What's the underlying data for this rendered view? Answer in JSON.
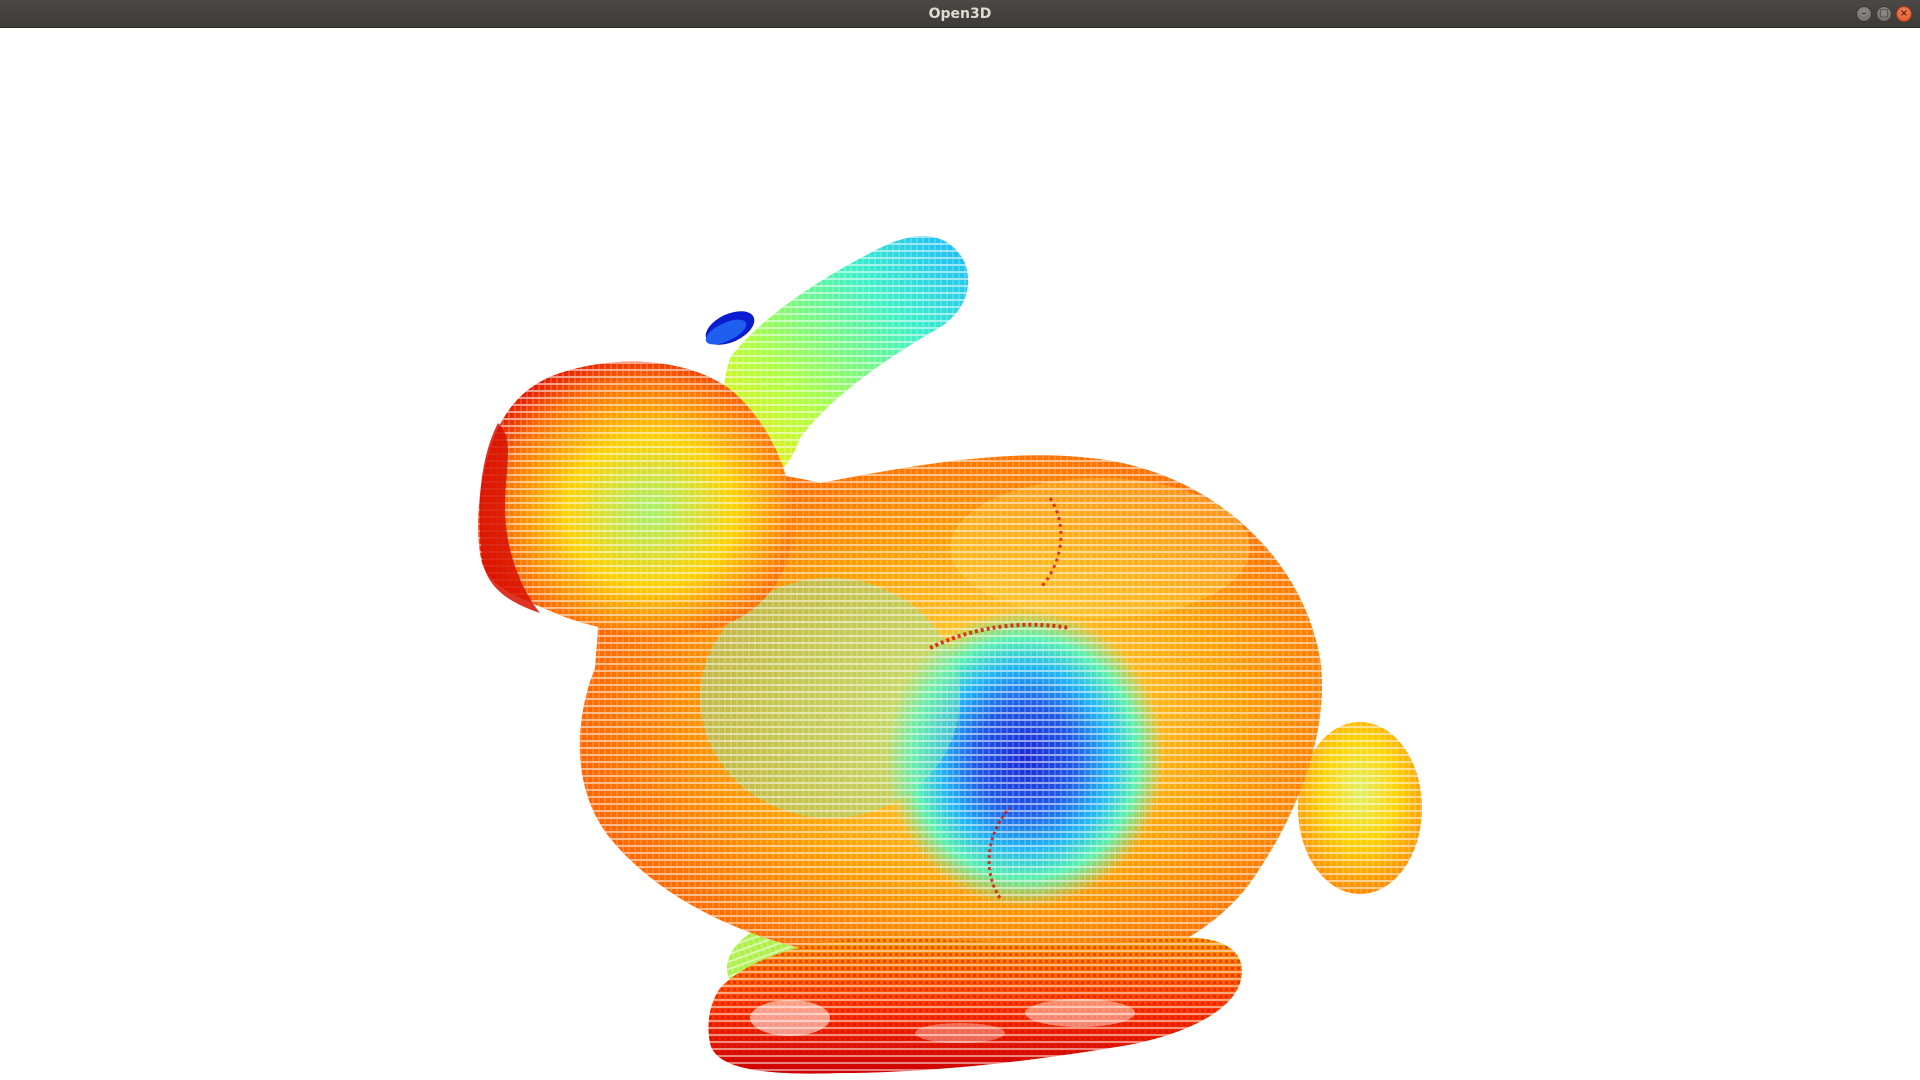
{
  "window": {
    "title": "Open3D",
    "controls": {
      "minimize_icon": "minimize-icon",
      "maximize_icon": "maximize-icon",
      "close_icon": "close-icon",
      "close_color": "#e95420"
    }
  },
  "viewport": {
    "background": "#ffffff",
    "content": "point-cloud",
    "colormap": [
      "#0000c8",
      "#00b4ff",
      "#00ffc8",
      "#b4ff00",
      "#ffff00",
      "#ff9600",
      "#ff3c00",
      "#d20000"
    ]
  }
}
